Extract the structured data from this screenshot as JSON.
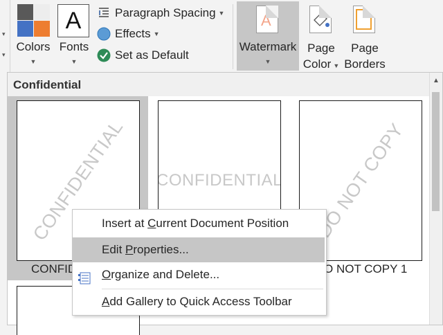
{
  "ribbon": {
    "colors_label": "Colors",
    "fonts_label": "Fonts",
    "fonts_glyph": "A",
    "paragraph_spacing": "Paragraph Spacing",
    "effects": "Effects",
    "set_as_default": "Set as Default",
    "watermark": "Watermark",
    "page_color_1": "Page",
    "page_color_2": "Color",
    "page_borders_1": "Page",
    "page_borders_2": "Borders",
    "swatch_colors": [
      "#595959",
      "#ededed",
      "#4472c4",
      "#ed7d31"
    ]
  },
  "gallery": {
    "header": "Confidential",
    "tiles": [
      {
        "watermark": "CONFIDENTIAL",
        "caption": "CONFID"
      },
      {
        "watermark": "CONFIDENTIAL",
        "caption": ""
      },
      {
        "watermark": "DO NOT COPY",
        "caption": "O NOT COPY 1"
      }
    ]
  },
  "context_menu": {
    "insert_pre": "Insert at ",
    "insert_u": "C",
    "insert_post": "urrent Document Position",
    "edit_pre": "Edit ",
    "edit_u": "P",
    "edit_post": "roperties...",
    "organize_u": "O",
    "organize_post": "rganize and Delete...",
    "add_u": "A",
    "add_post": "dd Gallery to Quick Access Toolbar"
  }
}
